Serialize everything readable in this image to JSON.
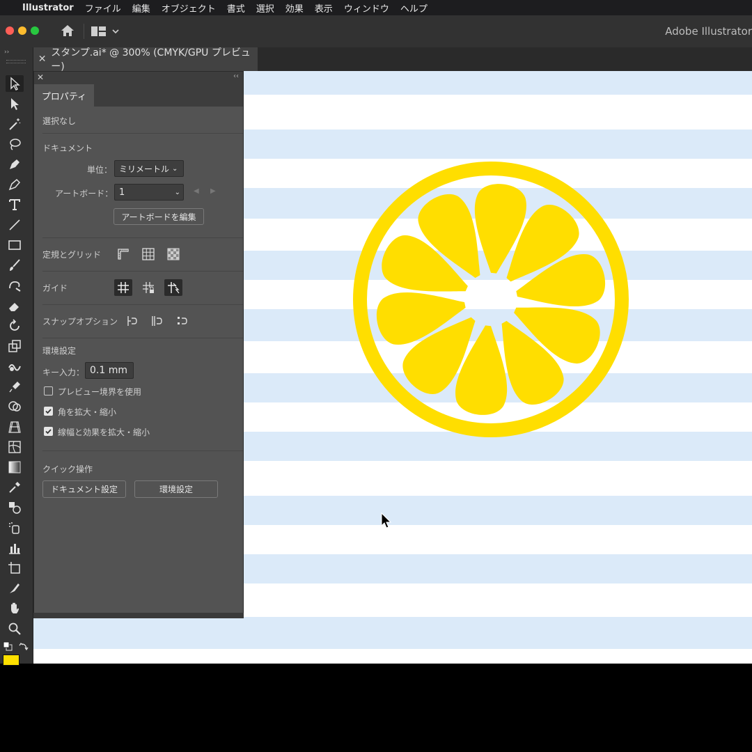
{
  "menubar": {
    "app_name": "Illustrator",
    "items": [
      "ファイル",
      "編集",
      "オブジェクト",
      "書式",
      "選択",
      "効果",
      "表示",
      "ウィンドウ",
      "ヘルプ"
    ]
  },
  "window": {
    "title": "Adobe Illustrator"
  },
  "document_tab": {
    "title": "スタンプ.ai* @ 300% (CMYK/GPU プレビュー)"
  },
  "panel": {
    "tab": "プロパティ",
    "selection_status": "選択なし",
    "document": {
      "title": "ドキュメント",
      "units_label": "単位：",
      "units_value": "ミリメートル",
      "artboard_label": "アートボード：",
      "artboard_value": "1",
      "edit_artboards_button": "アートボードを編集"
    },
    "rulers_grids_label": "定規とグリッド",
    "guides_label": "ガイド",
    "snap_label": "スナップオプション",
    "preferences": {
      "title": "環境設定",
      "key_increment_label": "キー入力：",
      "key_increment_value": "0.1 mm",
      "checkboxes": [
        {
          "label": "プレビュー境界を使用",
          "checked": false
        },
        {
          "label": "角を拡大・縮小",
          "checked": true
        },
        {
          "label": "線幅と効果を拡大・縮小",
          "checked": true
        }
      ]
    },
    "quick_actions": {
      "title": "クイック操作",
      "document_setup_button": "ドキュメント設定",
      "preferences_button": "環境設定"
    }
  },
  "colors": {
    "fill_swatch": "#ffe000",
    "lemon": "#ffde00",
    "stripe": "#dbeaf9"
  }
}
